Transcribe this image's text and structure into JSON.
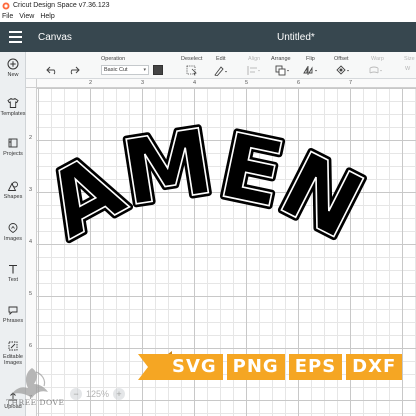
{
  "window": {
    "title": "Cricut Design Space  v7.36.123"
  },
  "menu": [
    "File",
    "View",
    "Help"
  ],
  "header": {
    "section": "Canvas",
    "doc_title": "Untitled*"
  },
  "sidebar": {
    "items": [
      {
        "label": "New",
        "icon": "plus-circle-icon"
      },
      {
        "label": "Templates",
        "icon": "shirt-icon"
      },
      {
        "label": "Projects",
        "icon": "projects-icon"
      },
      {
        "label": "Shapes",
        "icon": "shapes-icon"
      },
      {
        "label": "Images",
        "icon": "images-icon"
      },
      {
        "label": "Text",
        "icon": "text-icon"
      },
      {
        "label": "Phrases",
        "icon": "phrases-icon"
      },
      {
        "label": "Editable Images",
        "icon": "editable-images-icon"
      },
      {
        "label": "Upload",
        "icon": "upload-icon"
      }
    ]
  },
  "toolbar": {
    "operation_label": "Operation",
    "operation_value": "Basic Cut",
    "deselect_label": "Deselect",
    "edit_label": "Edit",
    "align_label": "Align",
    "arrange_label": "Arrange",
    "flip_label": "Flip",
    "offset_label": "Offset",
    "warp_label": "Warp",
    "size_label": "Size",
    "size_w": "W",
    "swatch_color": "#444444"
  },
  "rulers": {
    "top": [
      "2",
      "3",
      "4",
      "5",
      "6",
      "7"
    ],
    "left": [
      "2",
      "3",
      "4",
      "5",
      "6",
      "7"
    ]
  },
  "canvas": {
    "design_text": "AMEN"
  },
  "banner": {
    "formats": [
      "SVG",
      "PNG",
      "EPS",
      "DXF"
    ],
    "color": "#f5a623"
  },
  "zoom": {
    "level": "125%",
    "minus": "−",
    "plus": "+"
  },
  "watermark": {
    "text": "THREE DOVE"
  }
}
